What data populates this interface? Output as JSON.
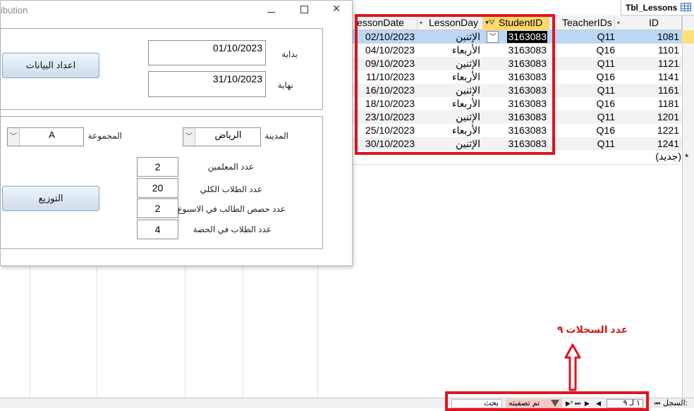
{
  "table": {
    "tab_name": "Tbl_Lessons",
    "columns": [
      "essonDate",
      "LessonDay",
      "StudentID",
      "TeacherIDs",
      "ID"
    ],
    "rows": [
      {
        "date": "02/10/2023",
        "day": "الإثنين",
        "student": "3163083",
        "teacher": "Q11",
        "id": "1081"
      },
      {
        "date": "04/10/2023",
        "day": "الأربعاء",
        "student": "3163083",
        "teacher": "Q16",
        "id": "1101"
      },
      {
        "date": "09/10/2023",
        "day": "الإثنين",
        "student": "3163083",
        "teacher": "Q11",
        "id": "1121"
      },
      {
        "date": "11/10/2023",
        "day": "الأربعاء",
        "student": "3163083",
        "teacher": "Q16",
        "id": "1141"
      },
      {
        "date": "16/10/2023",
        "day": "الإثنين",
        "student": "3163083",
        "teacher": "Q11",
        "id": "1161"
      },
      {
        "date": "18/10/2023",
        "day": "الأربعاء",
        "student": "3163083",
        "teacher": "Q16",
        "id": "1181"
      },
      {
        "date": "23/10/2023",
        "day": "الإثنين",
        "student": "3163083",
        "teacher": "Q11",
        "id": "1201"
      },
      {
        "date": "25/10/2023",
        "day": "الأربعاء",
        "student": "3163083",
        "teacher": "Q16",
        "id": "1221"
      },
      {
        "date": "30/10/2023",
        "day": "الإثنين",
        "student": "3163083",
        "teacher": "Q11",
        "id": "1241"
      }
    ],
    "new_row_marker": "*",
    "new_row_label": "(جديد)"
  },
  "annotation": {
    "text": "عدد السجلات ٩",
    "color": "#e0141e"
  },
  "nav": {
    "record_label": "السجل:",
    "first": "⏮",
    "position": "١ لـ ٩",
    "prev": "◀",
    "next": "▶",
    "last": "⏭",
    "new": "▶*",
    "filtered": "تم تصفيته",
    "search": "بحث"
  },
  "form": {
    "title": "ibution",
    "start_label": "بداية",
    "end_label": "نهاية",
    "start_date": "01/10/2023",
    "end_date": "31/10/2023",
    "prepare_button": "اعداد البيانات",
    "city_label": "المدينة",
    "city_value": "الرياض",
    "group_label": "المجموعة",
    "group_value": "A",
    "teachers_label": "عدد المعلمين",
    "teachers_value": "2",
    "students_label": "عدد الطلاب الكلي",
    "students_value": "20",
    "periods_label": "عدد حصص الطالب في الاسبوع",
    "periods_value": "2",
    "class_size_label": "عدد الطلاب في الحصة",
    "class_size_value": "4",
    "distribute_button": "التوزيع"
  }
}
